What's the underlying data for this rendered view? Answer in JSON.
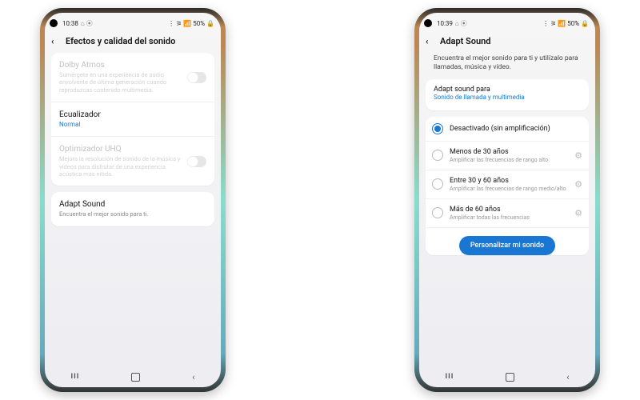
{
  "status": {
    "time_a": "10:38",
    "time_b": "10:39",
    "icons": "⌂ ⦿",
    "right": "⋮ ⚞ 📶 50% 🔒"
  },
  "screen_a": {
    "title": "Efectos y calidad del sonido",
    "dolby": {
      "title": "Dolby Atmos",
      "sub": "Sumérgete en una experiencia de audio envolvente de última generación cuando reproduzcas contenido multimedia."
    },
    "eq": {
      "title": "Ecualizador",
      "value": "Normal"
    },
    "uhq": {
      "title": "Optimizador UHQ",
      "sub": "Mejora la resolución de sonido de la música y vídeos para disfrutar de una experiencia acústica más nítida."
    },
    "adapt": {
      "title": "Adapt Sound",
      "sub": "Encuentra el mejor sonido para ti."
    }
  },
  "screen_b": {
    "title": "Adapt Sound",
    "intro": "Encuentra el mejor sonido para ti y utilízalo para llamadas, música y vídeo.",
    "section": "Adapt sound para",
    "section_value": "Sonido de llamada y multimedia",
    "opts": [
      {
        "t": "Desactivado (sin amplificación)",
        "s": ""
      },
      {
        "t": "Menos de 30 años",
        "s": "Amplificar las frecuencias de rango alto"
      },
      {
        "t": "Entre 30 y 60 años",
        "s": "Amplificar las frecuencias de rango medio/alto"
      },
      {
        "t": "Más de 60 años",
        "s": "Amplificar todas las frecuencias"
      }
    ],
    "cta": "Personalizar mi sonido"
  }
}
